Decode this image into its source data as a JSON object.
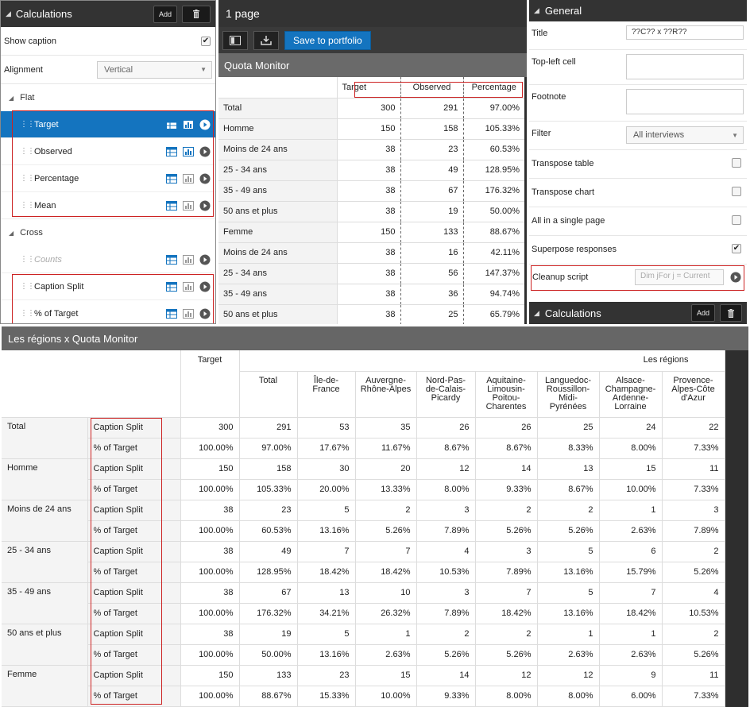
{
  "left": {
    "title": "Calculations",
    "add_label": "Add",
    "show_caption_label": "Show caption",
    "show_caption_checked": "✔",
    "alignment_label": "Alignment",
    "alignment_value": "Vertical",
    "flat_label": "Flat",
    "flat_items": [
      "Target",
      "Observed",
      "Percentage",
      "Mean"
    ],
    "cross_label": "Cross",
    "cross_items": [
      "Counts",
      "Caption Split",
      "% of Target"
    ]
  },
  "middle": {
    "title": "1 page",
    "save_label": "Save to portfolio",
    "table_title": "Quota Monitor",
    "columns": [
      "Target",
      "Observed",
      "Percentage"
    ],
    "rows": [
      {
        "label": "Total",
        "values": [
          "300",
          "291",
          "97.00%"
        ]
      },
      {
        "label": "Homme",
        "values": [
          "150",
          "158",
          "105.33%"
        ]
      },
      {
        "label": "Moins de 24 ans",
        "values": [
          "38",
          "23",
          "60.53%"
        ]
      },
      {
        "label": "25 - 34 ans",
        "values": [
          "38",
          "49",
          "128.95%"
        ]
      },
      {
        "label": "35 - 49 ans",
        "values": [
          "38",
          "67",
          "176.32%"
        ]
      },
      {
        "label": "50 ans et plus",
        "values": [
          "38",
          "19",
          "50.00%"
        ]
      },
      {
        "label": "Femme",
        "values": [
          "150",
          "133",
          "88.67%"
        ]
      },
      {
        "label": "Moins de 24 ans",
        "values": [
          "38",
          "16",
          "42.11%"
        ]
      },
      {
        "label": "25 - 34 ans",
        "values": [
          "38",
          "56",
          "147.37%"
        ]
      },
      {
        "label": "35 - 49 ans",
        "values": [
          "38",
          "36",
          "94.74%"
        ]
      },
      {
        "label": "50 ans et plus",
        "values": [
          "38",
          "25",
          "65.79%"
        ]
      }
    ]
  },
  "right": {
    "title": "General",
    "title_label": "Title",
    "title_value": "??C?? x ??R??",
    "top_left_label": "Top-left cell",
    "footnote_label": "Footnote",
    "filter_label": "Filter",
    "filter_value": "All interviews",
    "transpose_table_label": "Transpose table",
    "transpose_chart_label": "Transpose chart",
    "single_page_label": "All in a single page",
    "superpose_label": "Superpose responses",
    "superpose_checked": "✔",
    "cleanup_label": "Cleanup script",
    "cleanup_placeholder": "Dim jFor j = Current",
    "footer_title": "Calculations",
    "footer_add": "Add"
  },
  "bottom": {
    "title": "Les régions x Quota Monitor",
    "target_label": "Target",
    "group_label": "Les régions",
    "columns": [
      "Total",
      "Île-de-France",
      "Auvergne-Rhône-Alpes",
      "Nord-Pas-de-Calais-Picardy",
      "Aquitaine-Limousin-Poitou-Charentes",
      "Languedoc-Roussillon-Midi-Pyrénées",
      "Alsace-Champagne-Ardenne-Lorraine",
      "Provence-Alpes-Côte d'Azur"
    ],
    "caption_split": "Caption Split",
    "pct_target": "% of Target",
    "rows": [
      {
        "label": "Total",
        "target": "300",
        "target_pct": "100.00%",
        "split": [
          "291",
          "53",
          "35",
          "26",
          "26",
          "25",
          "24",
          "22"
        ],
        "pct": [
          "97.00%",
          "17.67%",
          "11.67%",
          "8.67%",
          "8.67%",
          "8.33%",
          "8.00%",
          "7.33%"
        ]
      },
      {
        "label": "Homme",
        "target": "150",
        "target_pct": "100.00%",
        "split": [
          "158",
          "30",
          "20",
          "12",
          "14",
          "13",
          "15",
          "11"
        ],
        "pct": [
          "105.33%",
          "20.00%",
          "13.33%",
          "8.00%",
          "9.33%",
          "8.67%",
          "10.00%",
          "7.33%"
        ]
      },
      {
        "label": "Moins de 24 ans",
        "target": "38",
        "target_pct": "100.00%",
        "split": [
          "23",
          "5",
          "2",
          "3",
          "2",
          "2",
          "1",
          "3"
        ],
        "pct": [
          "60.53%",
          "13.16%",
          "5.26%",
          "7.89%",
          "5.26%",
          "5.26%",
          "2.63%",
          "7.89%"
        ]
      },
      {
        "label": "25 - 34 ans",
        "target": "38",
        "target_pct": "100.00%",
        "split": [
          "49",
          "7",
          "7",
          "4",
          "3",
          "5",
          "6",
          "2"
        ],
        "pct": [
          "128.95%",
          "18.42%",
          "18.42%",
          "10.53%",
          "7.89%",
          "13.16%",
          "15.79%",
          "5.26%"
        ]
      },
      {
        "label": "35 - 49 ans",
        "target": "38",
        "target_pct": "100.00%",
        "split": [
          "67",
          "13",
          "10",
          "3",
          "7",
          "5",
          "7",
          "4"
        ],
        "pct": [
          "176.32%",
          "34.21%",
          "26.32%",
          "7.89%",
          "18.42%",
          "13.16%",
          "18.42%",
          "10.53%"
        ]
      },
      {
        "label": "50 ans et plus",
        "target": "38",
        "target_pct": "100.00%",
        "split": [
          "19",
          "5",
          "1",
          "2",
          "2",
          "1",
          "1",
          "2"
        ],
        "pct": [
          "50.00%",
          "13.16%",
          "2.63%",
          "5.26%",
          "5.26%",
          "2.63%",
          "2.63%",
          "5.26%"
        ]
      },
      {
        "label": "Femme",
        "target": "150",
        "target_pct": "100.00%",
        "split": [
          "133",
          "23",
          "15",
          "14",
          "12",
          "12",
          "9",
          "11"
        ],
        "pct": [
          "88.67%",
          "15.33%",
          "10.00%",
          "9.33%",
          "8.00%",
          "8.00%",
          "6.00%",
          "7.33%"
        ]
      }
    ]
  }
}
